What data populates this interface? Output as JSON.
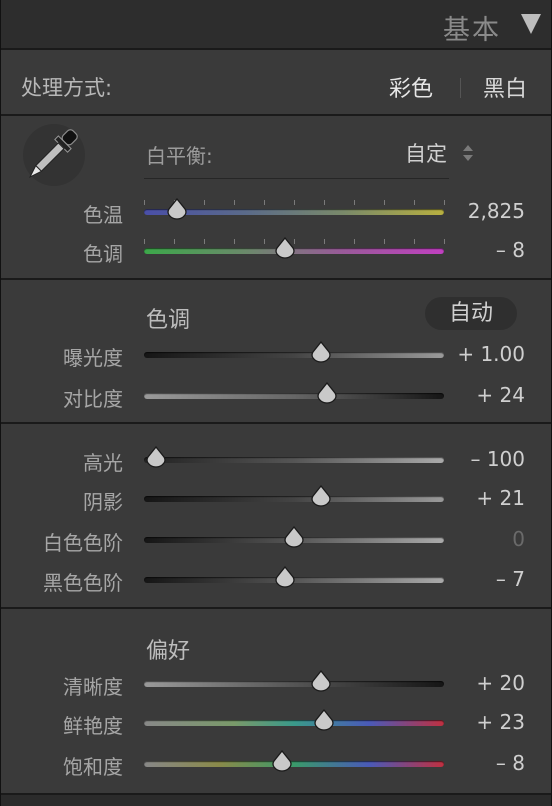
{
  "header": {
    "title": "基本"
  },
  "treatment": {
    "label": "处理方式:",
    "color": "彩色",
    "bw": "黑白"
  },
  "white_balance": {
    "label": "白平衡:",
    "value": "自定"
  },
  "tone": {
    "label": "色调",
    "auto": "自动"
  },
  "presence": {
    "label": "偏好"
  },
  "sliders": {
    "temp": {
      "label": "色温",
      "value": "2,825",
      "position": 0.11
    },
    "tint": {
      "label": "色调",
      "value": "– 8",
      "position": 0.47
    },
    "exposure": {
      "label": "曝光度",
      "value": "+ 1.00",
      "position": 0.59
    },
    "contrast": {
      "label": "对比度",
      "value": "+ 24",
      "position": 0.61
    },
    "highlights": {
      "label": "高光",
      "value": "– 100",
      "position": 0.04
    },
    "shadows": {
      "label": "阴影",
      "value": "+ 21",
      "position": 0.59
    },
    "whites": {
      "label": "白色色阶",
      "value": "0",
      "position": 0.5
    },
    "blacks": {
      "label": "黑色色阶",
      "value": "– 7",
      "position": 0.47
    },
    "clarity": {
      "label": "清晰度",
      "value": "+ 20",
      "position": 0.59
    },
    "vibrance": {
      "label": "鲜艳度",
      "value": "+ 23",
      "position": 0.6
    },
    "saturation": {
      "label": "饱和度",
      "value": "– 8",
      "position": 0.46
    }
  },
  "icons": {
    "eyedropper": "eyedropper-icon",
    "collapse": "triangle-down-icon",
    "stepper": "updown-arrows-icon"
  },
  "colors": {
    "panel": "#3a3a3a",
    "header": "#2d2d2d",
    "text": "#c8c8c8"
  }
}
